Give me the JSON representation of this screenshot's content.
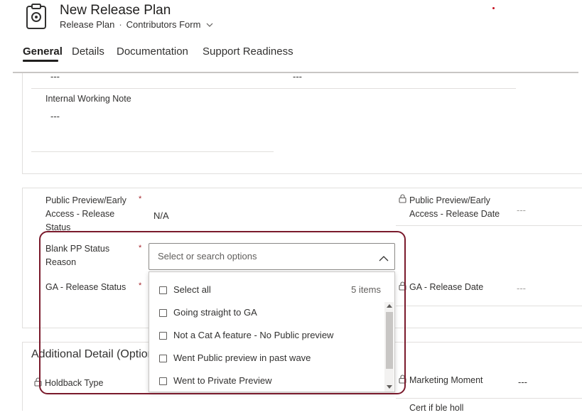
{
  "header": {
    "title": "New Release Plan",
    "entity": "Release Plan",
    "separator": "·",
    "form_name": "Contributors Form",
    "form_icon": "clipboard-icon"
  },
  "tabs": [
    {
      "label": "General",
      "active": true
    },
    {
      "label": "Details",
      "active": false
    },
    {
      "label": "Documentation",
      "active": false
    },
    {
      "label": "Support Readiness",
      "active": false
    }
  ],
  "section1": {
    "top_left_value": "---",
    "top_right_value": "---",
    "internal_note_label": "Internal Working Note",
    "internal_note_value": "---"
  },
  "section2": {
    "pp_status_label_1": "Public Preview/Early",
    "pp_status_label_2": "Access - Release",
    "pp_status_label_3": "Status",
    "pp_status_value": "N/A",
    "pp_date_label_1": "Public Preview/Early",
    "pp_date_label_2": "Access - Release Date",
    "pp_date_value": "---",
    "pp_reason_label_1": "Blank PP Status",
    "pp_reason_label_2": "Reason",
    "ga_status_label": "GA - Release Status",
    "ga_date_label": "GA - Release Date",
    "ga_date_value": "---",
    "required_marker": "*"
  },
  "combo": {
    "placeholder": "Select or search options",
    "select_all_label": "Select all",
    "count_label": "5 items",
    "options": [
      "Going straight to GA",
      "Not a Cat A feature - No Public preview",
      "Went Public preview in past wave",
      "Went to Private Preview"
    ]
  },
  "section3": {
    "title": "Additional Detail (Optional)",
    "holdback_label": "Holdback Type",
    "marketing_label": "Marketing Moment",
    "marketing_value": "---",
    "cut_off_label": "Cert if ble holl"
  },
  "colors": {
    "highlight_border": "#7a1a2c",
    "required": "#a4262c",
    "divider": "#e1dfdd"
  }
}
